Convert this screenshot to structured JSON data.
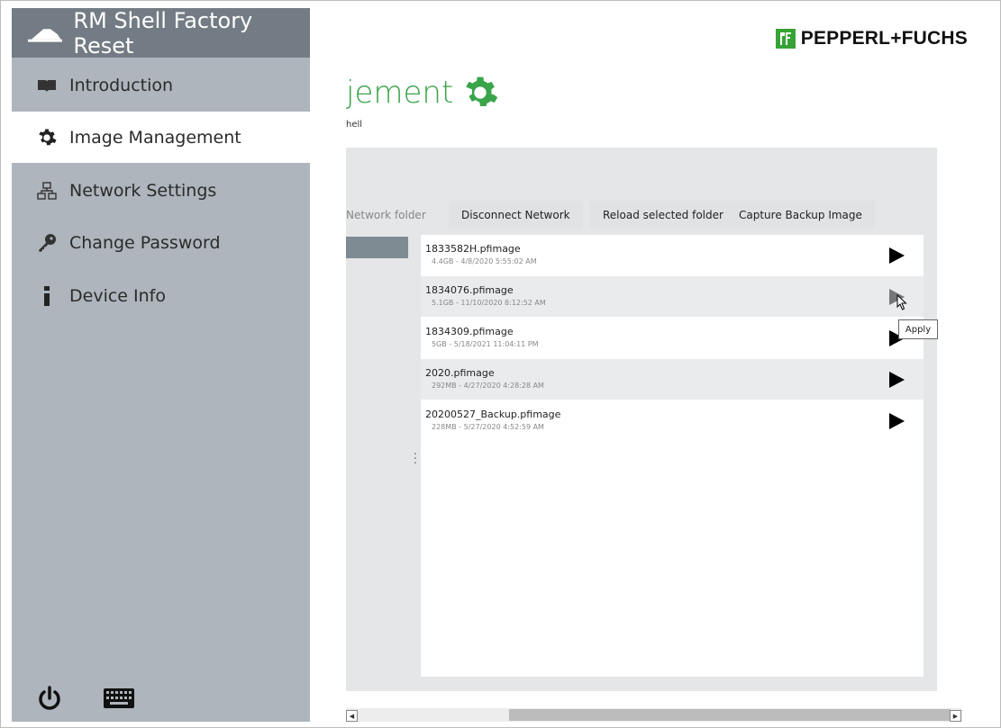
{
  "app": {
    "title": "RM Shell Factory Reset"
  },
  "sidebar": {
    "items": [
      {
        "label": "Introduction",
        "icon": "book-icon"
      },
      {
        "label": "Image Management",
        "icon": "gear-icon",
        "active": true
      },
      {
        "label": "Network Settings",
        "icon": "network-icon"
      },
      {
        "label": "Change Password",
        "icon": "key-icon"
      },
      {
        "label": "Device Info",
        "icon": "info-icon"
      }
    ],
    "bottom": [
      {
        "icon": "power-icon"
      },
      {
        "icon": "keyboard-icon"
      }
    ]
  },
  "brand": {
    "name": "PEPPERL+FUCHS"
  },
  "page": {
    "title": "jement",
    "subtitle": "hell"
  },
  "toolbar": {
    "network_folder": "Network folder",
    "disconnect": "Disconnect Network",
    "reload": "Reload selected folder",
    "capture": "Capture Backup Image"
  },
  "images": [
    {
      "name": "1833582H.pfimage",
      "meta": "4.4GB - 4/8/2020 5:55:02 AM"
    },
    {
      "name": "1834076.pfimage",
      "meta": "5.1GB - 11/10/2020 8:12:52 AM"
    },
    {
      "name": "1834309.pfimage",
      "meta": "5GB - 5/18/2021 11:04:11 PM"
    },
    {
      "name": "2020.pfimage",
      "meta": "292MB - 4/27/2020 4:28:28 AM"
    },
    {
      "name": "20200527_Backup.pfimage",
      "meta": "228MB - 5/27/2020 4:52:59 AM"
    }
  ],
  "tooltip": {
    "text": "Apply"
  },
  "colors": {
    "accent": "#3aa44a",
    "sidebar": "#aeb5bc",
    "header": "#737c84"
  }
}
